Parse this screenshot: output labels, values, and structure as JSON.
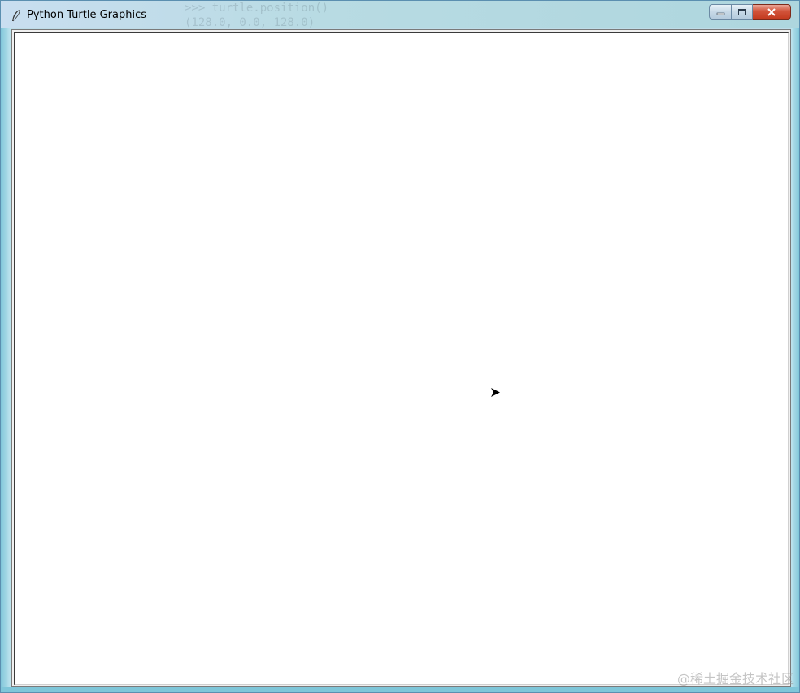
{
  "window": {
    "title": "Python Turtle Graphics",
    "icon": "feather-icon",
    "controls": {
      "minimize_icon": "minimize-icon",
      "maximize_icon": "maximize-icon",
      "close_icon": "close-icon"
    }
  },
  "background_text": {
    "line1": ">>> turtle.position()",
    "line2": "(128.0, 0.0, 128.0)"
  },
  "canvas": {
    "background": "#ffffff",
    "turtle_icon": "turtle-arrow-icon",
    "turtle_color": "#000000"
  },
  "watermark": "@稀土掘金技术社区"
}
